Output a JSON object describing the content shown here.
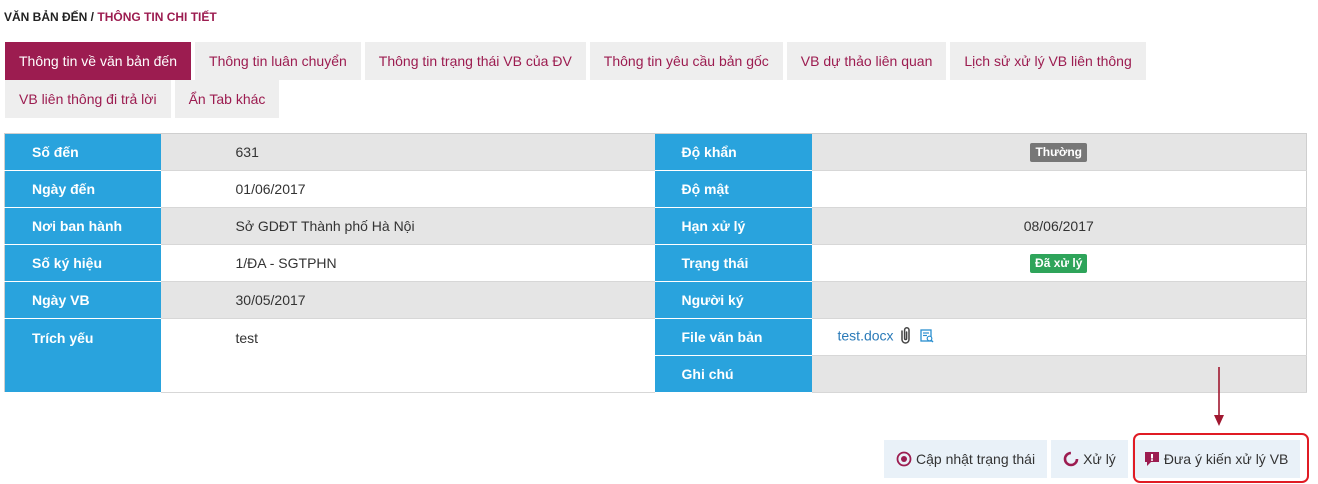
{
  "breadcrumb": {
    "root": "VĂN BẢN ĐẾN",
    "separator": " / ",
    "current": "THÔNG TIN CHI TIẾT"
  },
  "tabs": {
    "row1": [
      "Thông tin về văn bản đến",
      "Thông tin luân chuyển",
      "Thông tin trạng thái VB của ĐV",
      "Thông tin yêu cầu bản gốc",
      "VB dự thảo liên quan",
      "Lịch sử xử lý VB liên thông"
    ],
    "row2": [
      "VB liên thông đi trả lời",
      "Ẩn Tab khác"
    ],
    "active": "Thông tin về văn bản đến"
  },
  "details": {
    "so_den": {
      "label": "Số đến",
      "value": "631"
    },
    "ngay_den": {
      "label": "Ngày đến",
      "value": "01/06/2017"
    },
    "noi_ban_hanh": {
      "label": "Nơi ban hành",
      "value": "Sở GDĐT Thành phố Hà Nội"
    },
    "so_ky_hieu": {
      "label": "Số ký hiệu",
      "value": "1/ĐA - SGTPHN"
    },
    "ngay_vb": {
      "label": "Ngày VB",
      "value": "30/05/2017"
    },
    "trich_yeu": {
      "label": "Trích yếu",
      "value": "test"
    },
    "do_khan": {
      "label": "Độ khẩn",
      "value": "Thường"
    },
    "do_mat": {
      "label": "Độ mật",
      "value": ""
    },
    "han_xu_ly": {
      "label": "Hạn xử lý",
      "value": "08/06/2017"
    },
    "trang_thai": {
      "label": "Trạng thái",
      "value": "Đã xử lý"
    },
    "nguoi_ky": {
      "label": "Người ký",
      "value": ""
    },
    "file_van_ban": {
      "label": "File văn bản",
      "value": "test.docx"
    },
    "ghi_chu": {
      "label": "Ghi chú",
      "value": ""
    }
  },
  "actions": {
    "update_status": "Cập nhật trạng thái",
    "process": "Xử lý",
    "give_opinion": "Đưa ý kiến xử lý VB"
  },
  "colors": {
    "brand": "#9c1c50",
    "label_bg": "#29a3dd",
    "badge_normal": "#777777",
    "badge_done": "#2ea45a",
    "highlight": "#e01b24"
  }
}
